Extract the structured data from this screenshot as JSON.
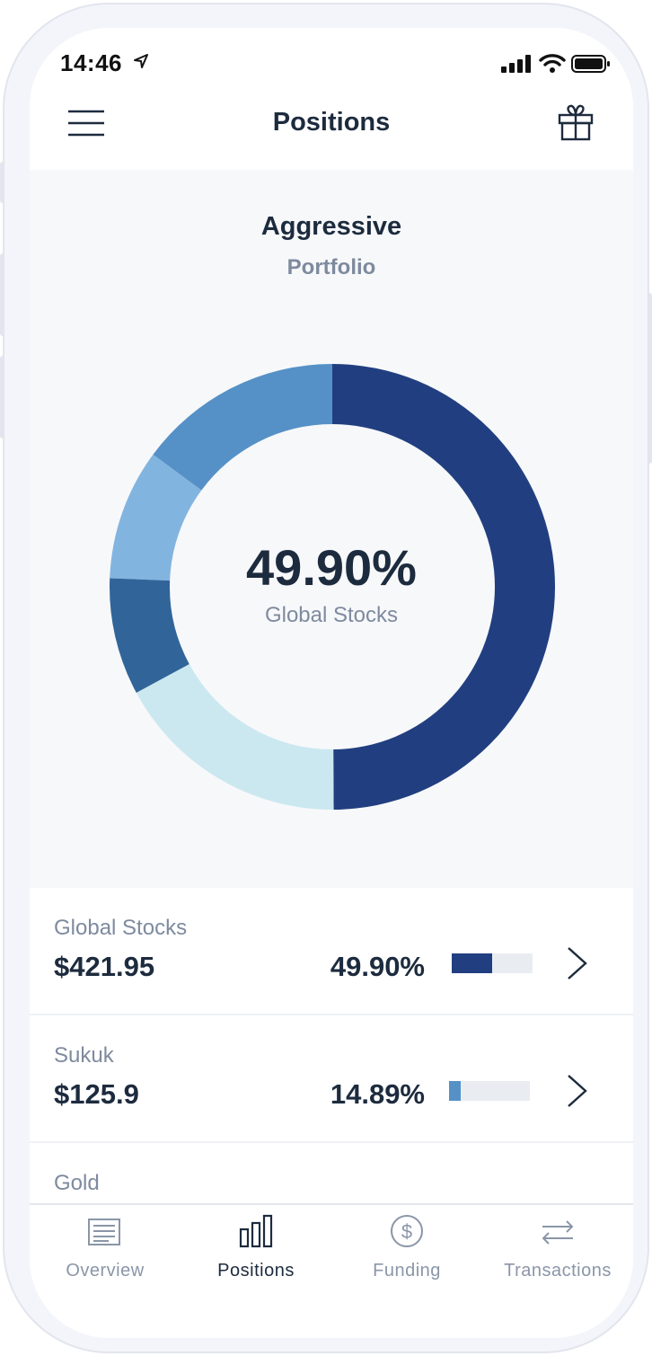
{
  "status_bar": {
    "time": "14:46",
    "icons": [
      "location-arrow-icon",
      "signal-bars-icon",
      "wifi-icon",
      "battery-icon"
    ]
  },
  "header": {
    "title": "Positions",
    "menu_icon": "hamburger-menu-icon",
    "gift_icon": "gift-icon"
  },
  "portfolio": {
    "name": "Aggressive",
    "subtitle": "Portfolio"
  },
  "chart_center": {
    "value": "49.90%",
    "label": "Global Stocks"
  },
  "chart_data": {
    "type": "pie",
    "style": "donut",
    "slices": [
      {
        "label": "Global Stocks",
        "value": 49.9,
        "color": "#213f80"
      },
      {
        "label": "Sukuk",
        "value": 14.89,
        "color": "#5591c7"
      },
      {
        "label": "",
        "value": 9.5,
        "color": "#82b4e0"
      },
      {
        "label": "",
        "value": 8.5,
        "color": "#31659a"
      },
      {
        "label": "",
        "value": 17.21,
        "color": "#cbe8f0"
      }
    ]
  },
  "positions": [
    {
      "name": "Global Stocks",
      "amount": "$421.95",
      "percent": "49.90%",
      "share": 0.499,
      "bar_color": "#213f80"
    },
    {
      "name": "Sukuk",
      "amount": "$125.9",
      "percent": "14.89%",
      "share": 0.1489,
      "bar_color": "#5591c7"
    },
    {
      "name": "Gold",
      "amount": "",
      "percent": "",
      "share": null,
      "bar_color": ""
    }
  ],
  "tabs": [
    {
      "label": "Overview",
      "icon": "overview-icon",
      "active": false
    },
    {
      "label": "Positions",
      "icon": "bar-chart-icon",
      "active": true
    },
    {
      "label": "Funding",
      "icon": "dollar-circle-icon",
      "active": false
    },
    {
      "label": "Transactions",
      "icon": "transfer-arrows-icon",
      "active": false
    }
  ],
  "colors": {
    "navy": "#213f80",
    "text_dark": "#1d2b3e",
    "text_muted": "#7e8a9e",
    "bar_track": "#e9edf2"
  }
}
